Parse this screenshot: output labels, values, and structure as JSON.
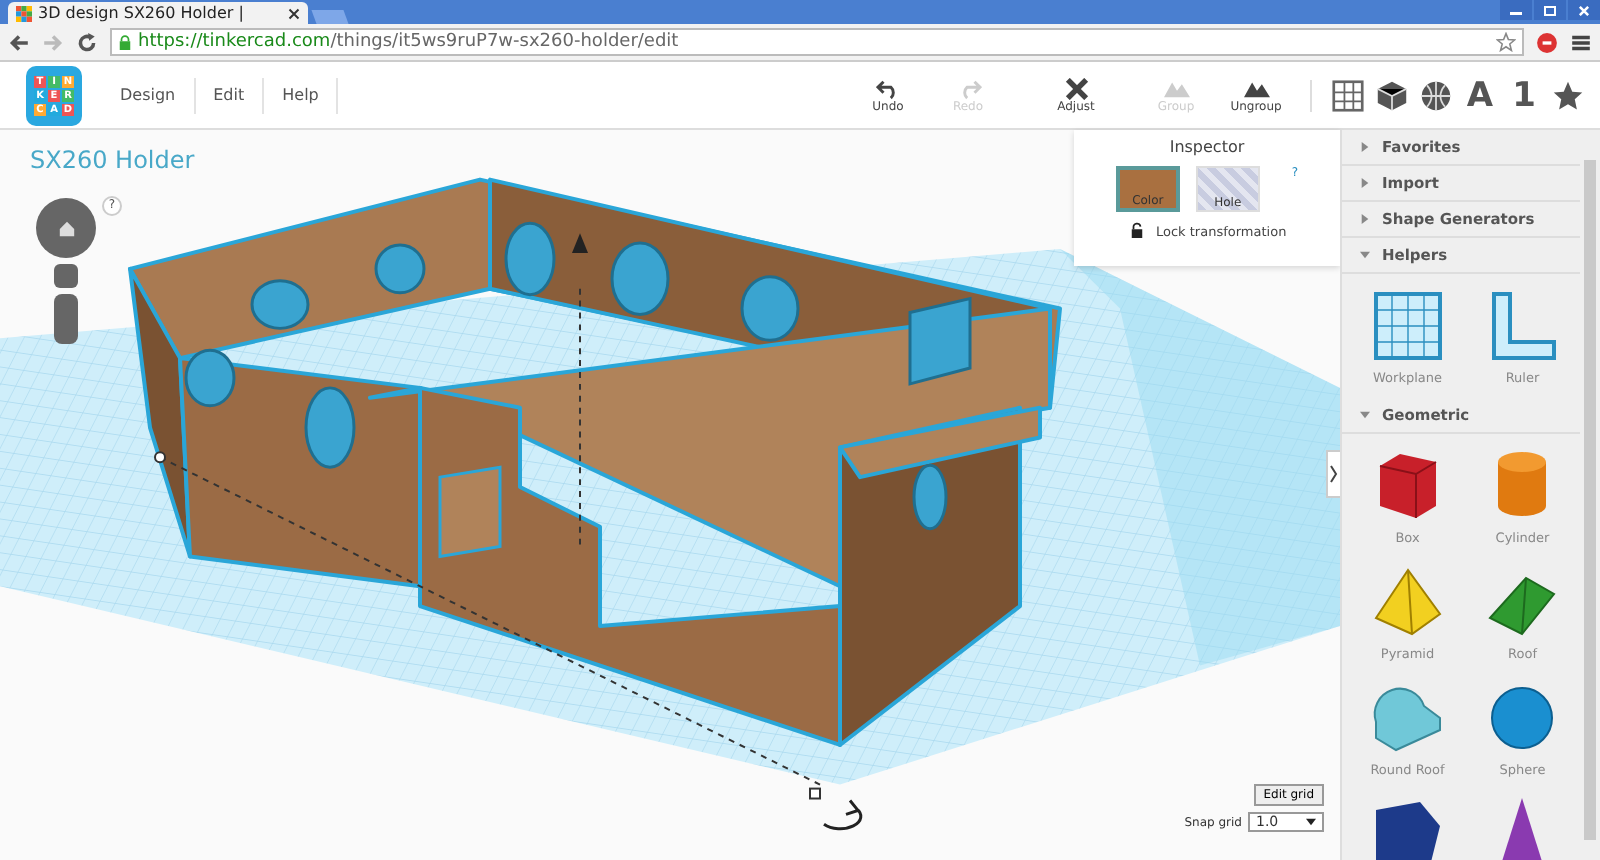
{
  "browser": {
    "tab_title": "3D design SX260 Holder |",
    "url_host": "https://tinkercad.com",
    "url_path": "/things/it5ws9ruP7w-sx260-holder/edit"
  },
  "app": {
    "logo_letters": [
      "T",
      "I",
      "N",
      "K",
      "E",
      "R",
      "C",
      "A",
      "D"
    ],
    "menu": [
      "Design",
      "Edit",
      "Help"
    ]
  },
  "toolbar": [
    {
      "kind": "undo",
      "label": "Undo",
      "disabled": false
    },
    {
      "kind": "redo",
      "label": "Redo",
      "disabled": true
    },
    {
      "kind": "adjust",
      "label": "Adjust",
      "disabled": false
    },
    {
      "kind": "group",
      "label": "Group",
      "disabled": true
    },
    {
      "kind": "ungroup",
      "label": "Ungroup",
      "disabled": false
    }
  ],
  "view_buttons": [
    {
      "kind": "grid"
    },
    {
      "kind": "box"
    },
    {
      "kind": "globe"
    },
    {
      "kind": "text",
      "label": "A"
    },
    {
      "kind": "text",
      "label": "1"
    },
    {
      "kind": "star"
    }
  ],
  "canvas": {
    "design_title": "SX260 Holder",
    "help": "?",
    "edit_grid": "Edit grid",
    "snap_grid_label": "Snap grid",
    "snap_grid_value": "1.0"
  },
  "inspector": {
    "title": "Inspector",
    "help": "?",
    "swatches": [
      {
        "label": "Color",
        "selected": true
      },
      {
        "label": "Hole",
        "selected": false
      }
    ],
    "lock": "Lock transformation"
  },
  "sidebar": {
    "sections": [
      {
        "title": "Favorites",
        "expanded": false
      },
      {
        "title": "Import",
        "expanded": false
      },
      {
        "title": "Shape Generators",
        "expanded": false
      },
      {
        "title": "Helpers",
        "expanded": true,
        "items": [
          {
            "kind": "workplane",
            "label": "Workplane"
          },
          {
            "kind": "ruler",
            "label": "Ruler"
          }
        ]
      },
      {
        "title": "Geometric",
        "expanded": true,
        "items": [
          {
            "kind": "box",
            "label": "Box"
          },
          {
            "kind": "cylinder",
            "label": "Cylinder"
          },
          {
            "kind": "pyramid",
            "label": "Pyramid"
          },
          {
            "kind": "roof",
            "label": "Roof"
          },
          {
            "kind": "roundroof",
            "label": "Round Roof"
          },
          {
            "kind": "sphere",
            "label": "Sphere"
          },
          {
            "kind": "polygon"
          },
          {
            "kind": "cone"
          }
        ]
      }
    ]
  }
}
